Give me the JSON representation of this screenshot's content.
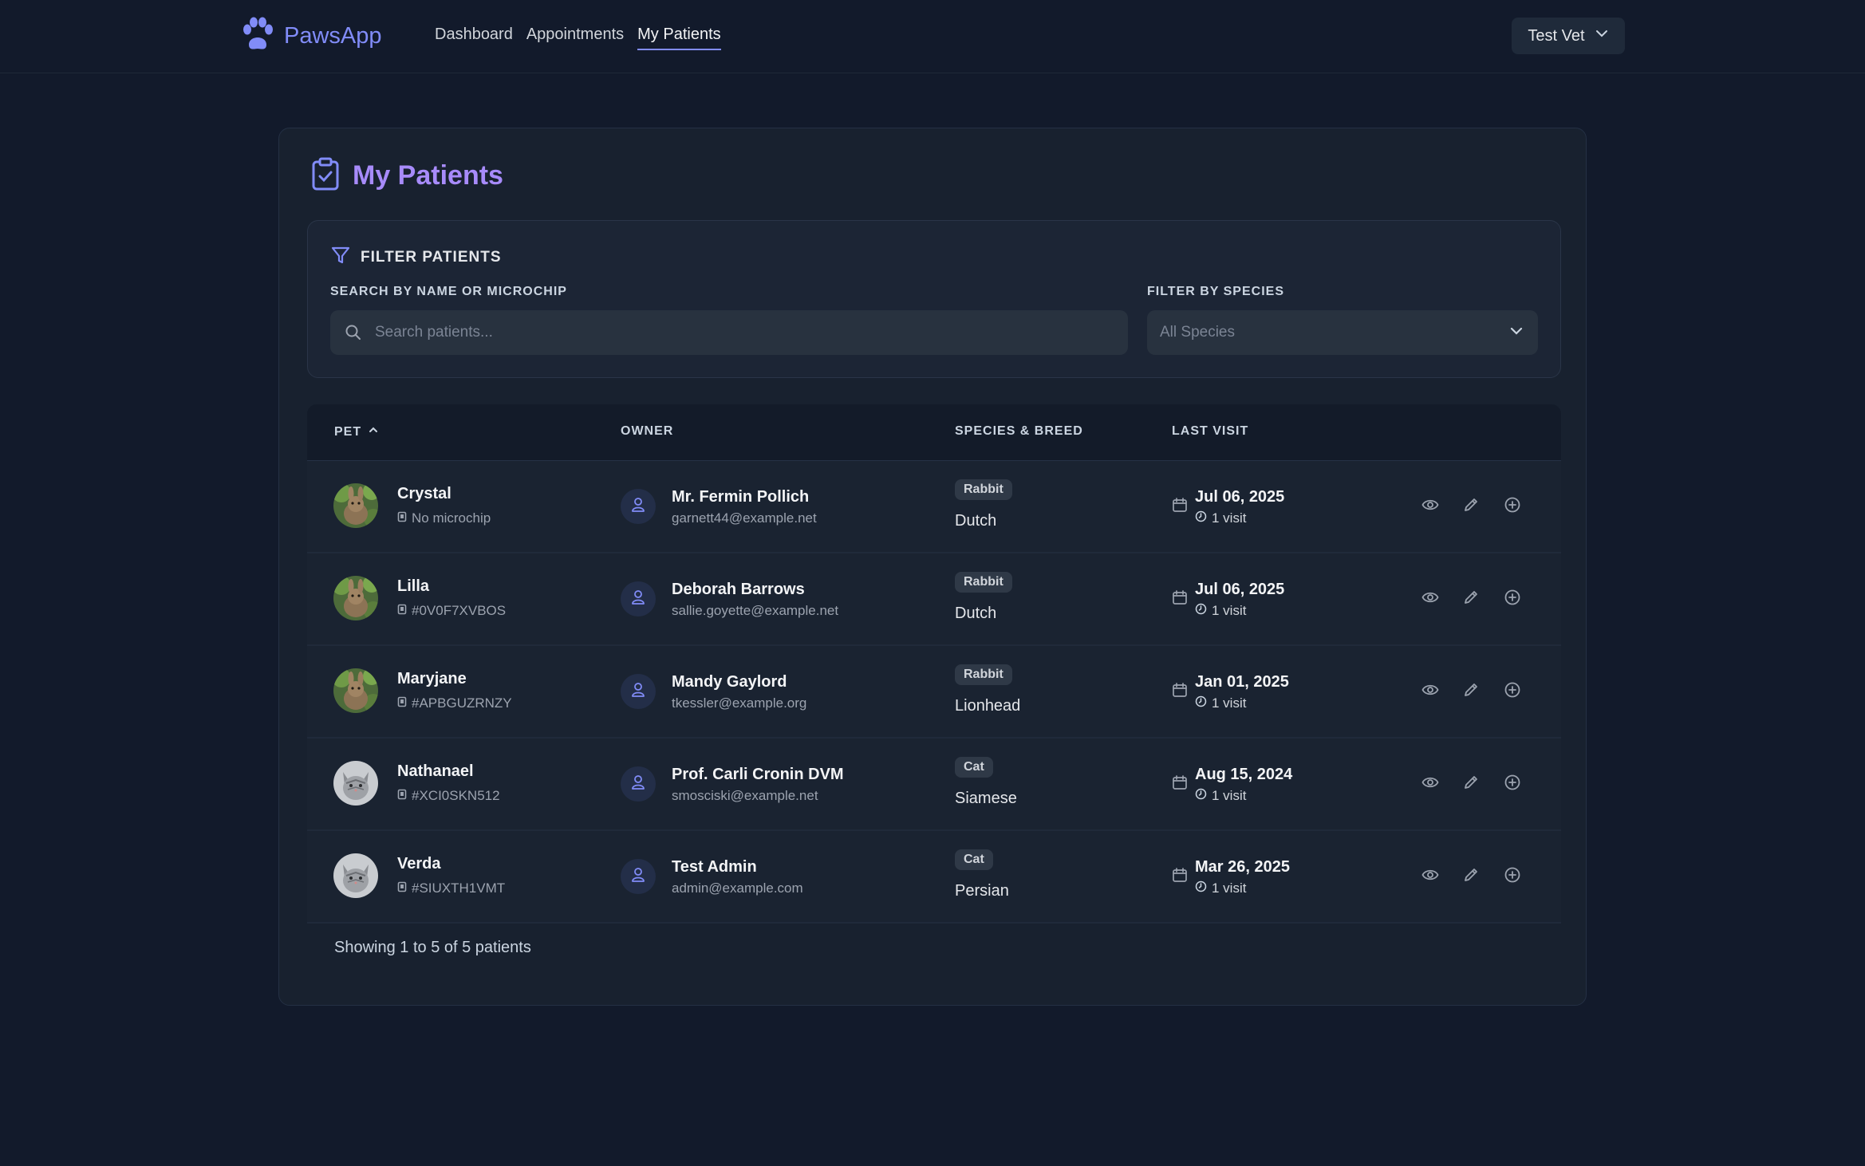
{
  "app": {
    "name": "PawsApp",
    "nav": [
      "Dashboard",
      "Appointments",
      "My Patients"
    ],
    "active_nav": "My Patients",
    "user": "Test Vet"
  },
  "page": {
    "title": "My Patients"
  },
  "filter": {
    "title": "FILTER PATIENTS",
    "search_label": "SEARCH BY NAME OR MICROCHIP",
    "search_placeholder": "Search patients...",
    "search_value": "",
    "species_label": "FILTER BY SPECIES",
    "species_value": "All Species"
  },
  "table": {
    "headers": {
      "pet": "PET",
      "owner": "OWNER",
      "species": "SPECIES & BREED",
      "last_visit": "LAST VISIT"
    },
    "sort": "pet-ascending",
    "rows": [
      {
        "pet": "Crystal",
        "chip": "No microchip",
        "avatar": "rabbit-photo",
        "owner": "Mr. Fermin Pollich",
        "email": "garnett44@example.net",
        "species": "Rabbit",
        "breed": "Dutch",
        "date": "Jul 06, 2025",
        "visits": "1 visit"
      },
      {
        "pet": "Lilla",
        "chip": "#0V0F7XVBOS",
        "avatar": "rabbit-photo",
        "owner": "Deborah Barrows",
        "email": "sallie.goyette@example.net",
        "species": "Rabbit",
        "breed": "Dutch",
        "date": "Jul 06, 2025",
        "visits": "1 visit"
      },
      {
        "pet": "Maryjane",
        "chip": "#APBGUZRNZY",
        "avatar": "rabbit-photo",
        "owner": "Mandy Gaylord",
        "email": "tkessler@example.org",
        "species": "Rabbit",
        "breed": "Lionhead",
        "date": "Jan 01, 2025",
        "visits": "1 visit"
      },
      {
        "pet": "Nathanael",
        "chip": "#XCI0SKN512",
        "avatar": "cat-photo",
        "owner": "Prof. Carli Cronin DVM",
        "email": "smosciski@example.net",
        "species": "Cat",
        "breed": "Siamese",
        "date": "Aug 15, 2024",
        "visits": "1 visit"
      },
      {
        "pet": "Verda",
        "chip": "#SIUXTH1VMT",
        "avatar": "cat-photo",
        "owner": "Test Admin",
        "email": "admin@example.com",
        "species": "Cat",
        "breed": "Persian",
        "date": "Mar 26, 2025",
        "visits": "1 visit"
      }
    ]
  },
  "pagination": {
    "text": "Showing 1 to 5 of 5 patients"
  },
  "colors": {
    "background": "#121a2b",
    "accent": "#818cf8",
    "title": "#a78bfa",
    "card": "#18212f"
  },
  "icons": [
    "paw-icon",
    "clipboard-check-icon",
    "filter-icon",
    "search-icon",
    "chevron-down-icon",
    "chevron-up-icon",
    "microchip-icon",
    "user-icon",
    "calendar-icon",
    "clock-icon",
    "eye-icon",
    "pencil-icon",
    "plus-circle-icon"
  ]
}
